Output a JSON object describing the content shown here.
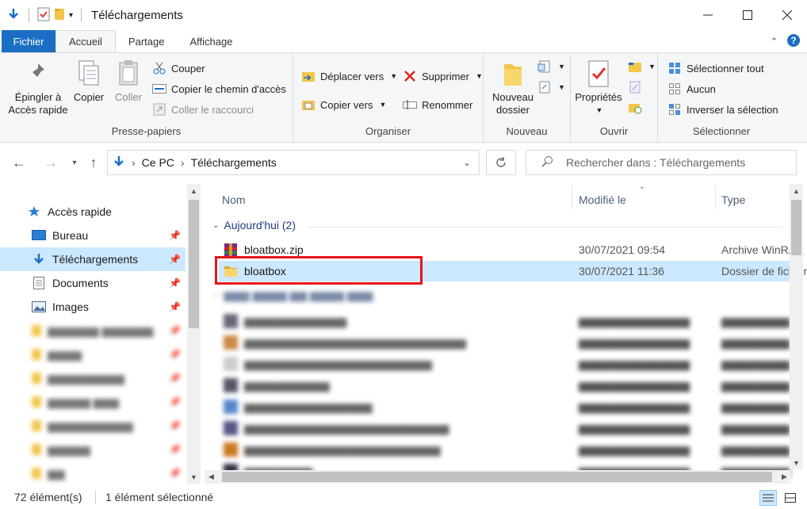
{
  "window": {
    "title": "Téléchargements"
  },
  "ribbon_tabs": [
    "Fichier",
    "Accueil",
    "Partage",
    "Affichage"
  ],
  "ribbon": {
    "presse_papiers": {
      "label": "Presse-papiers",
      "pin_label_1": "Épingler à",
      "pin_label_2": "Accès rapide",
      "copy": "Copier",
      "paste": "Coller",
      "cut": "Couper",
      "copy_path": "Copier le chemin d'accès",
      "paste_shortcut": "Coller le raccourci"
    },
    "organiser": {
      "label": "Organiser",
      "move_to": "Déplacer vers",
      "copy_to": "Copier vers",
      "delete": "Supprimer",
      "rename": "Renommer"
    },
    "nouveau": {
      "label": "Nouveau",
      "new_folder_1": "Nouveau",
      "new_folder_2": "dossier"
    },
    "ouvrir": {
      "label": "Ouvrir",
      "properties": "Propriétés"
    },
    "selectionner": {
      "label": "Sélectionner",
      "select_all": "Sélectionner tout",
      "select_none": "Aucun",
      "invert": "Inverser la sélection"
    }
  },
  "address": {
    "crumbs": [
      "Ce PC",
      "Téléchargements"
    ],
    "search_placeholder": "Rechercher dans : Téléchargements"
  },
  "nav": {
    "quick_access": "Accès rapide",
    "items": [
      {
        "label": "Bureau",
        "icon": "desktop-icon",
        "pinned": true
      },
      {
        "label": "Téléchargements",
        "icon": "download-icon",
        "pinned": true,
        "selected": true
      },
      {
        "label": "Documents",
        "icon": "documents-icon",
        "pinned": true
      },
      {
        "label": "Images",
        "icon": "images-icon",
        "pinned": true
      }
    ]
  },
  "columns": {
    "name": "Nom",
    "modified": "Modifié le",
    "type": "Type"
  },
  "groups": {
    "today": "Aujourd'hui (2)"
  },
  "files": [
    {
      "name": "bloatbox.zip",
      "date": "30/07/2021 09:54",
      "type": "Archive WinRAR ZIP",
      "icon": "winrar-icon"
    },
    {
      "name": "bloatbox",
      "date": "30/07/2021 11:36",
      "type": "Dossier de fichiers",
      "icon": "folder-icon",
      "selected": true
    }
  ],
  "status": {
    "count": "72 élément(s)",
    "selected": "1 élément sélectionné"
  },
  "colors": {
    "accent": "#1a6fc4",
    "selection": "#cce8ff",
    "highlight_box": "#e8141b"
  }
}
